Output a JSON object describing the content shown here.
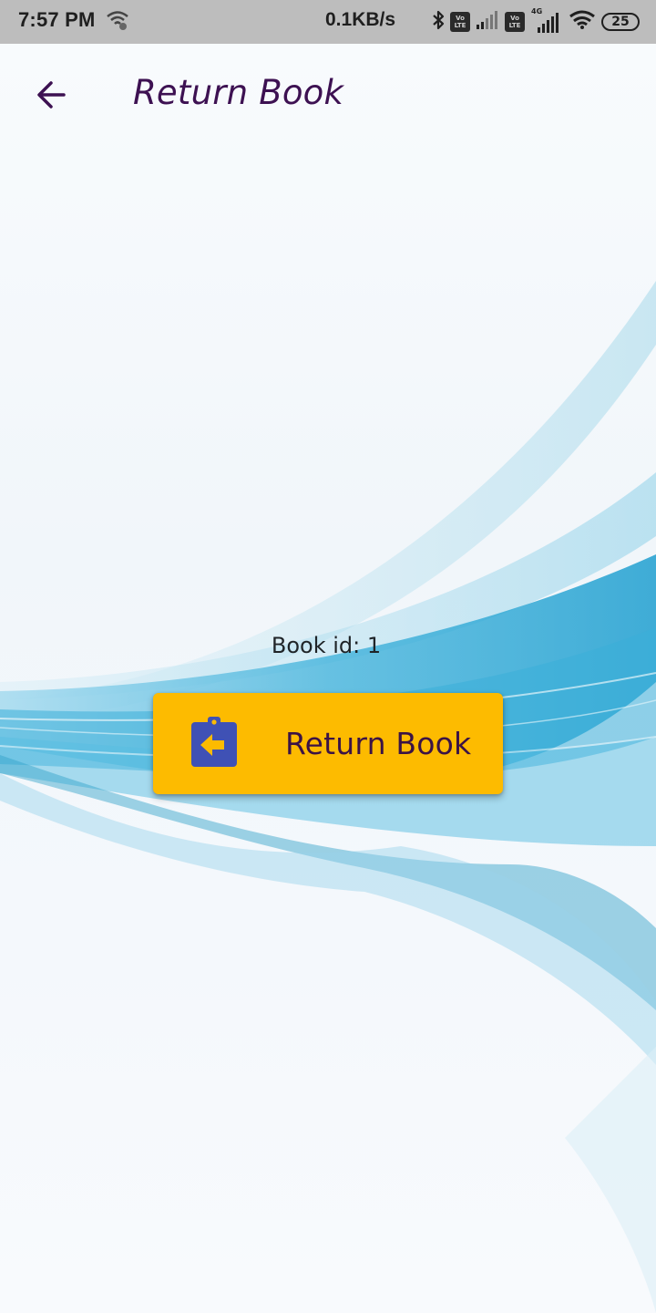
{
  "status_bar": {
    "time": "7:57 PM",
    "net_speed": "0.1KB/s",
    "volte_1": "Vo LTE",
    "volte_2": "Vo LTE",
    "network_type": "4G",
    "battery_level": "25",
    "icons": [
      "wifi-icon",
      "bluetooth-icon",
      "signal-icon",
      "wifi-icon",
      "battery-icon"
    ]
  },
  "app_bar": {
    "title": "Return Book",
    "back_icon": "arrow-back-icon"
  },
  "main": {
    "book_id_text": "Book id: 1",
    "return_button_label": "Return Book",
    "return_button_icon": "assignment-return-icon"
  },
  "colors": {
    "title": "#3d1152",
    "button_bg": "#fdbb00",
    "button_text": "#3b1345",
    "icon_blue": "#3f51b5",
    "icon_arrow": "#fdbb00",
    "status_bar": "#bdbdbd"
  }
}
